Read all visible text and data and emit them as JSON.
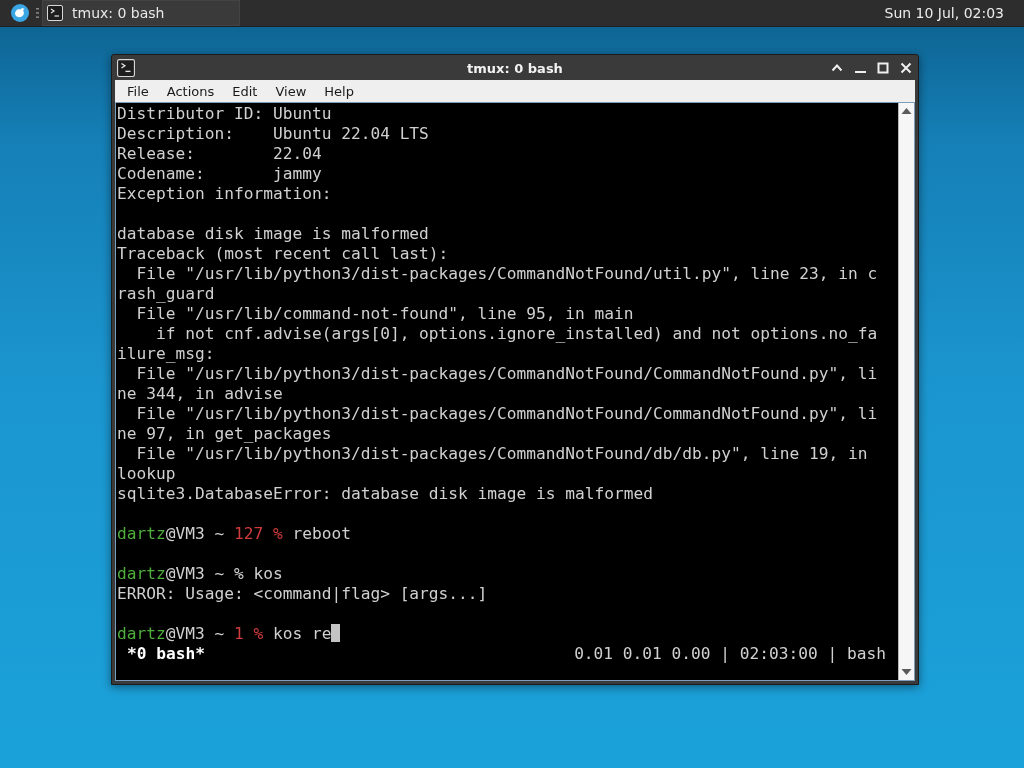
{
  "top_panel": {
    "task_button": {
      "label": "tmux: 0 bash",
      "selected": true
    },
    "clock": "Sun 10 Jul, 02:03"
  },
  "window": {
    "title": "tmux: 0 bash",
    "menu": [
      "File",
      "Actions",
      "Edit",
      "View",
      "Help"
    ]
  },
  "terminal": {
    "lines": [
      {
        "kind": "text",
        "text": "Distributor ID: Ubuntu"
      },
      {
        "kind": "text",
        "text": "Description:    Ubuntu 22.04 LTS"
      },
      {
        "kind": "text",
        "text": "Release:        22.04"
      },
      {
        "kind": "text",
        "text": "Codename:       jammy"
      },
      {
        "kind": "text",
        "text": "Exception information:"
      },
      {
        "kind": "blank"
      },
      {
        "kind": "text",
        "text": "database disk image is malformed"
      },
      {
        "kind": "text",
        "text": "Traceback (most recent call last):"
      },
      {
        "kind": "text",
        "text": "  File \"/usr/lib/python3/dist-packages/CommandNotFound/util.py\", line 23, in c"
      },
      {
        "kind": "text",
        "text": "rash_guard"
      },
      {
        "kind": "text",
        "text": "  File \"/usr/lib/command-not-found\", line 95, in main"
      },
      {
        "kind": "text",
        "text": "    if not cnf.advise(args[0], options.ignore_installed) and not options.no_fa"
      },
      {
        "kind": "text",
        "text": "ilure_msg:"
      },
      {
        "kind": "text",
        "text": "  File \"/usr/lib/python3/dist-packages/CommandNotFound/CommandNotFound.py\", li"
      },
      {
        "kind": "text",
        "text": "ne 344, in advise"
      },
      {
        "kind": "text",
        "text": "  File \"/usr/lib/python3/dist-packages/CommandNotFound/CommandNotFound.py\", li"
      },
      {
        "kind": "text",
        "text": "ne 97, in get_packages"
      },
      {
        "kind": "text",
        "text": "  File \"/usr/lib/python3/dist-packages/CommandNotFound/db/db.py\", line 19, in"
      },
      {
        "kind": "text",
        "text": "lookup"
      },
      {
        "kind": "text",
        "text": "sqlite3.DatabaseError: database disk image is malformed"
      },
      {
        "kind": "blank"
      },
      {
        "kind": "prompt",
        "cursor": false,
        "segments": [
          {
            "kind": "user",
            "text": "dartz"
          },
          {
            "kind": "plain",
            "text": "@VM3 ~ "
          },
          {
            "kind": "status",
            "text": "127 %"
          },
          {
            "kind": "plain",
            "text": " reboot"
          }
        ]
      },
      {
        "kind": "blank"
      },
      {
        "kind": "prompt",
        "cursor": false,
        "segments": [
          {
            "kind": "user",
            "text": "dartz"
          },
          {
            "kind": "plain",
            "text": "@VM3 ~ % kos"
          }
        ]
      },
      {
        "kind": "text",
        "text": "ERROR: Usage: <command|flag> [args...]"
      },
      {
        "kind": "blank"
      },
      {
        "kind": "prompt",
        "cursor": true,
        "segments": [
          {
            "kind": "user",
            "text": "dartz"
          },
          {
            "kind": "plain",
            "text": "@VM3 ~ "
          },
          {
            "kind": "status",
            "text": "1 %"
          },
          {
            "kind": "plain",
            "text": " kos re"
          }
        ]
      }
    ],
    "status_bar": {
      "window_label": "*0 bash*",
      "info": "0.01 0.01 0.00 | 02:03:00 | bash"
    }
  }
}
